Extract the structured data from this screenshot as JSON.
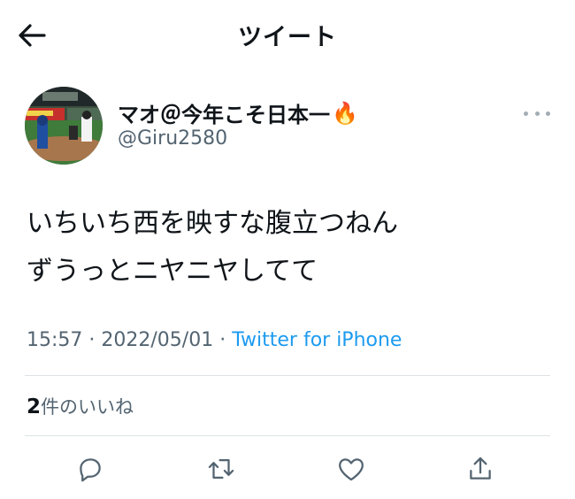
{
  "header": {
    "title": "ツイート",
    "back_icon": "arrow-left-icon"
  },
  "tweet": {
    "author_name": "マオ＠今年こそ日本一",
    "author_emoji": "🔥",
    "handle": "@Giru2580",
    "text_lines": [
      "いちいち西を映すな腹立つねん",
      "ずうっとニヤニヤしてて"
    ],
    "time": "15:57",
    "date": "2022/05/01",
    "separator": "·",
    "source": "Twitter for iPhone",
    "likes_count": "2",
    "likes_label": "件のいいね"
  },
  "actions": [
    "reply-icon",
    "retweet-icon",
    "like-icon",
    "share-icon"
  ],
  "colors": {
    "link": "#1d9bf0",
    "muted": "#536471",
    "divider": "#dfe3e6"
  }
}
